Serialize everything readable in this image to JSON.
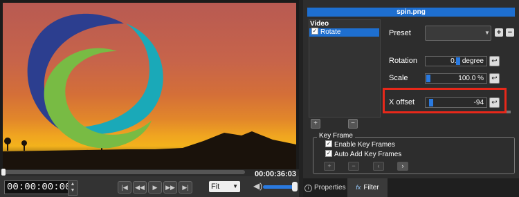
{
  "player": {
    "end_time": "00:00:36:03",
    "current_time": "00:00:00:00",
    "zoom": "Fit",
    "transport_icons": [
      "skip-back-icon",
      "rewind-icon",
      "play-icon",
      "fast-forward-icon",
      "skip-forward-icon"
    ],
    "transport_glyphs": [
      "|◀",
      "◀◀",
      "▶",
      "▶▶",
      "▶|"
    ],
    "volume_level": 0.95
  },
  "filter_panel": {
    "title": "spin.png",
    "list_header": "Video",
    "items": [
      {
        "label": "Rotate",
        "checked": true
      }
    ],
    "preset_label": "Preset",
    "params": [
      {
        "label": "Rotation",
        "value": "0.0 degree"
      },
      {
        "label": "Scale",
        "value": "100.0 %"
      },
      {
        "label": "X offset",
        "value": "-94"
      }
    ],
    "keyframe": {
      "title": "Key Frame",
      "enable_label": "Enable Key Frames",
      "auto_add_label": "Auto Add Key Frames"
    }
  },
  "tabs": {
    "properties": "Properties",
    "filter": "Filter",
    "filter_icon": "fx"
  },
  "colors": {
    "accent": "#1e6fd0",
    "highlight": "#e8281a",
    "logo_navy": "#2c3e8f",
    "logo_teal": "#1aa9b8",
    "logo_green": "#78bb44"
  }
}
